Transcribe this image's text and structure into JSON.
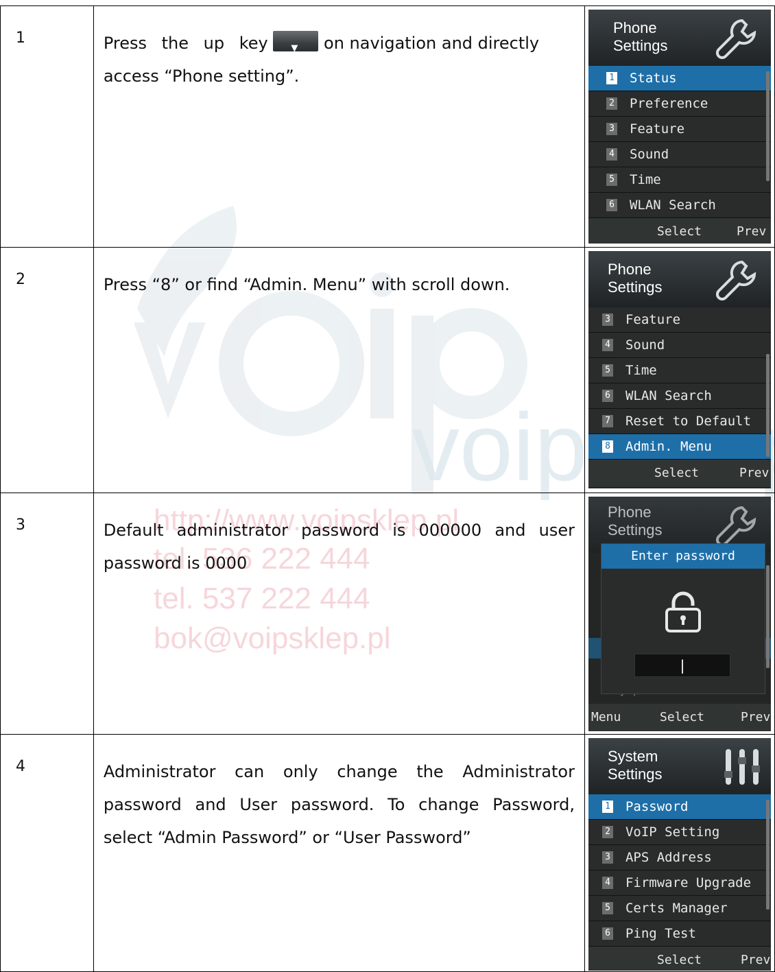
{
  "watermark": {
    "url": "http://www.voipsklep.pl",
    "tel1": "tel. 536 222 444",
    "tel2": "tel. 537 222 444",
    "email": "bok@voipsklep.pl",
    "logo_text": "voipsklep"
  },
  "rows": [
    {
      "num": "1",
      "text_before": "Press the up key",
      "text_after": "on navigation and directly access “Phone setting”.",
      "screen": {
        "title_line1": "Phone",
        "title_line2": "Settings",
        "icon": "wrench-icon",
        "items": [
          {
            "n": "1",
            "label": "Status"
          },
          {
            "n": "2",
            "label": "Preference"
          },
          {
            "n": "3",
            "label": "Feature"
          },
          {
            "n": "4",
            "label": "Sound"
          },
          {
            "n": "5",
            "label": "Time"
          },
          {
            "n": "6",
            "label": "WLAN Search"
          }
        ],
        "selected_index": 0,
        "soft_left": "",
        "soft_center": "Select",
        "soft_right": "Prev"
      }
    },
    {
      "num": "2",
      "text": "Press “8” or find “Admin. Menu” with scroll down.",
      "screen": {
        "title_line1": "Phone",
        "title_line2": "Settings",
        "icon": "wrench-icon",
        "items": [
          {
            "n": "3",
            "label": "Feature"
          },
          {
            "n": "4",
            "label": "Sound"
          },
          {
            "n": "5",
            "label": "Time"
          },
          {
            "n": "6",
            "label": "WLAN Search"
          },
          {
            "n": "7",
            "label": "Reset to Default"
          },
          {
            "n": "8",
            "label": "Admin. Menu"
          }
        ],
        "selected_index": 5,
        "soft_left": "",
        "soft_center": "Select",
        "soft_right": "Prev"
      }
    },
    {
      "num": "3",
      "text": "Default administrator password is 000000 and user password is 0000",
      "screen": {
        "title_line1": "Phone",
        "title_line2": "Settings",
        "icon": "wrench-icon",
        "dialog_title": "Enter password",
        "lock_icon": "lock-icon",
        "input_value": "|",
        "behind_text": "My phone info.",
        "soft_left": "Menu",
        "soft_center": "Select",
        "soft_right": "Prev"
      }
    },
    {
      "num": "4",
      "text": "Administrator can only change the Administrator password and User password. To change Password, select “Admin Password” or “User Password”",
      "screen": {
        "title_line1": "System",
        "title_line2": "Settings",
        "icon": "sliders-icon",
        "items": [
          {
            "n": "1",
            "label": "Password"
          },
          {
            "n": "2",
            "label": "VoIP Setting"
          },
          {
            "n": "3",
            "label": "APS Address"
          },
          {
            "n": "4",
            "label": "Firmware Upgrade"
          },
          {
            "n": "5",
            "label": "Certs Manager"
          },
          {
            "n": "6",
            "label": "Ping Test"
          }
        ],
        "selected_index": 0,
        "soft_left": "",
        "soft_center": "Select",
        "soft_right": "Prev"
      }
    }
  ],
  "colors": {
    "selection": "#1e6fa8",
    "screen_bg": "#232625",
    "watermark": "#f4c9cf"
  }
}
